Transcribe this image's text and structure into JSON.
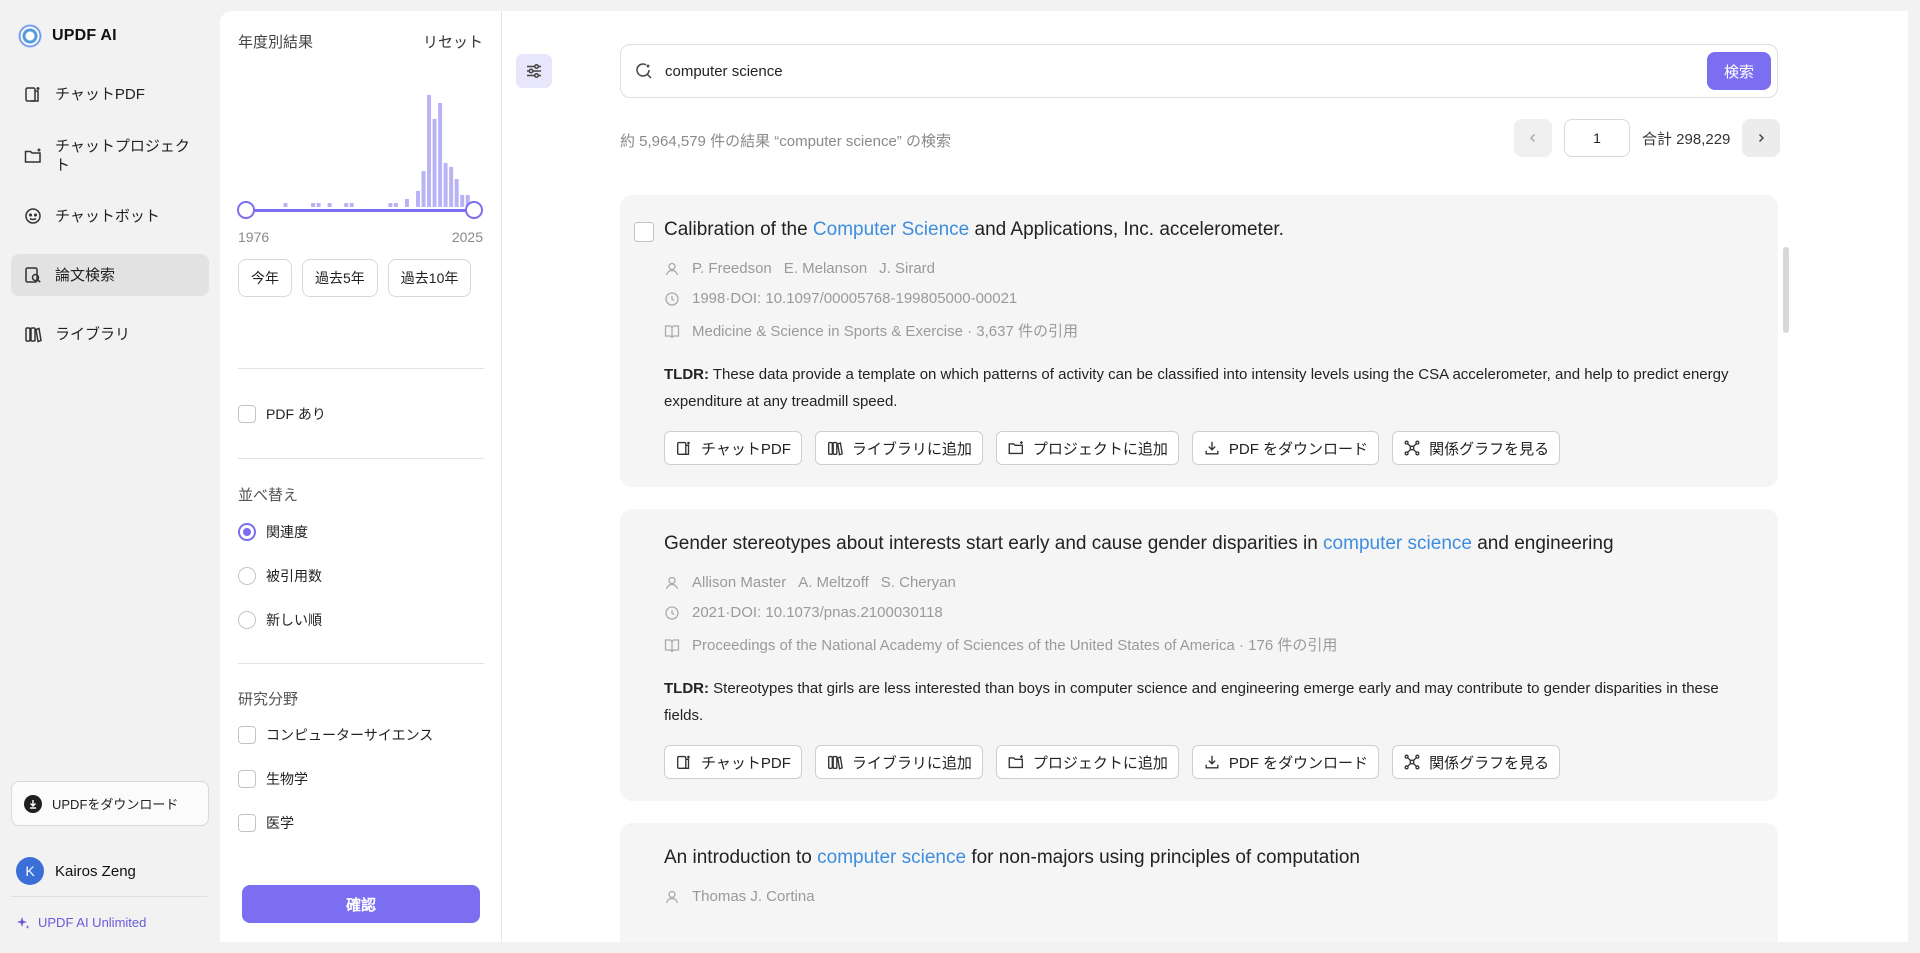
{
  "app": {
    "name": "UPDF AI"
  },
  "sidebar": {
    "items": [
      {
        "label": "チャットPDF",
        "icon": "chat-pdf-icon"
      },
      {
        "label": "チャットプロジェクト",
        "icon": "folder-chat-icon"
      },
      {
        "label": "チャットボット",
        "icon": "bot-icon"
      },
      {
        "label": "論文検索",
        "icon": "paper-search-icon"
      },
      {
        "label": "ライブラリ",
        "icon": "library-icon"
      }
    ],
    "download_app": "UPDFをダウンロード",
    "user": {
      "initial": "K",
      "name": "Kairos Zeng"
    },
    "plan": "UPDF AI Unlimited"
  },
  "filters": {
    "year_title": "年度別結果",
    "reset": "リセット",
    "histogram": [
      1,
      0,
      0,
      0,
      0,
      0,
      0,
      1,
      0,
      0,
      0,
      0,
      1,
      1,
      0,
      1,
      0,
      0,
      1,
      1,
      0,
      0,
      0,
      0,
      0,
      0,
      1,
      1,
      0,
      2,
      0,
      4,
      9,
      28,
      22,
      26,
      11,
      10,
      7,
      3,
      3,
      0
    ],
    "year_min": "1976",
    "year_max": "2025",
    "quick_ranges": [
      "今年",
      "過去5年",
      "過去10年"
    ],
    "has_pdf": "PDF あり",
    "sort_title": "並べ替え",
    "sort_options": [
      "関連度",
      "被引用数",
      "新しい順"
    ],
    "sort_selected": 0,
    "field_title": "研究分野",
    "fields": [
      "コンピューターサイエンス",
      "生物学",
      "医学"
    ],
    "confirm": "確認",
    "accent": "#7c6ef1"
  },
  "search": {
    "query": "computer science",
    "button": "検索",
    "result_count": "約 5,964,579 件の結果 “computer science” の検索"
  },
  "pagination": {
    "page": "1",
    "total": "合計 298,229"
  },
  "results": [
    {
      "title_before": "Calibration of the ",
      "title_hl": "Computer Science",
      "title_after": " and Applications, Inc. accelerometer.",
      "authors": [
        "P. Freedson",
        "E. Melanson",
        "J. Sirard"
      ],
      "date_doi": "1998·DOI: 10.1097/00005768-199805000-00021",
      "venue": "Medicine & Science in Sports & Exercise · 3,637 件の引用",
      "tldr_label": "TLDR:",
      "tldr": " These data provide a template on which patterns of activity can be classified into intensity levels using the CSA accelerometer, and help to predict energy expenditure at any treadmill speed."
    },
    {
      "title_before": "Gender stereotypes about interests start early and cause gender disparities in ",
      "title_hl": "computer science",
      "title_after": " and engineering",
      "authors": [
        "Allison Master",
        "A. Meltzoff",
        "S. Cheryan"
      ],
      "date_doi": "2021·DOI: 10.1073/pnas.2100030118",
      "venue": "Proceedings of the National Academy of Sciences of the United States of America · 176 件の引用",
      "tldr_label": "TLDR:",
      "tldr": " Stereotypes that girls are less interested than boys in computer science and engineering emerge early and may contribute to gender disparities in these fields."
    },
    {
      "title_before": "An introduction to ",
      "title_hl": "computer science",
      "title_after": " for non-majors using principles of computation",
      "authors": [
        "Thomas J. Cortina"
      ]
    }
  ],
  "actions": [
    "チャットPDF",
    "ライブラリに追加",
    "プロジェクトに追加",
    "PDF をダウンロード",
    "関係グラフを見る"
  ]
}
